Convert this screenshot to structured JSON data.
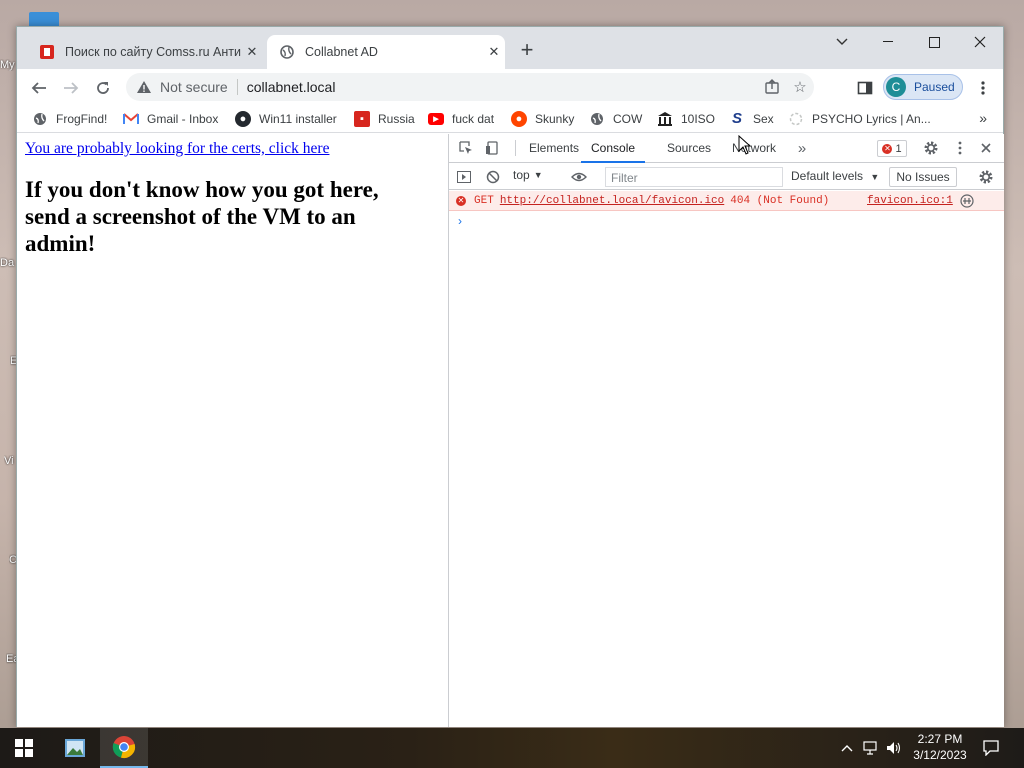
{
  "desktop": {
    "icon_labels": [
      "My",
      "Da",
      "E",
      "Vi",
      "C",
      "Ea"
    ]
  },
  "browser": {
    "tabs": [
      {
        "title": "Поиск по сайту Comss.ru Антиви",
        "icon": "comss-icon",
        "active": false
      },
      {
        "title": "Collabnet AD",
        "icon": "globe-icon",
        "active": true
      }
    ],
    "address": {
      "security_text": "Not secure",
      "url": "collabnet.local"
    },
    "profile": {
      "initial": "C",
      "status": "Paused"
    },
    "bookmarks": [
      {
        "label": "FrogFind!",
        "icon": "globe-icon"
      },
      {
        "label": "Gmail - Inbox",
        "icon": "gmail-icon"
      },
      {
        "label": "Win11 installer",
        "icon": "github-icon"
      },
      {
        "label": "Russia",
        "icon": "comss-icon"
      },
      {
        "label": "fuck dat",
        "icon": "youtube-icon"
      },
      {
        "label": "Skunky",
        "icon": "reddit-icon"
      },
      {
        "label": "COW",
        "icon": "globe-icon"
      },
      {
        "label": "10ISO",
        "icon": "museum-icon"
      },
      {
        "label": "Sex",
        "icon": "s-icon"
      },
      {
        "label": "PSYCHO Lyrics | An...",
        "icon": "loading-icon"
      }
    ]
  },
  "page": {
    "link_text": "You are probably looking for the certs, click here",
    "heading": "If you don't know how you got here, send a screenshot of the VM to an admin!"
  },
  "devtools": {
    "tabs": [
      "Elements",
      "Console",
      "Sources",
      "Network"
    ],
    "active_tab": "Console",
    "error_count": "1",
    "context": "top",
    "filter_placeholder": "Filter",
    "levels": "Default levels",
    "issues": "No Issues",
    "console": {
      "error": {
        "method": "GET",
        "url": "http://collabnet.local/favicon.ico",
        "status": "404 (Not Found)",
        "source": "favicon.ico:1"
      },
      "prompt": "›"
    }
  },
  "taskbar": {
    "time": "2:27 PM",
    "date": "3/12/2023"
  }
}
